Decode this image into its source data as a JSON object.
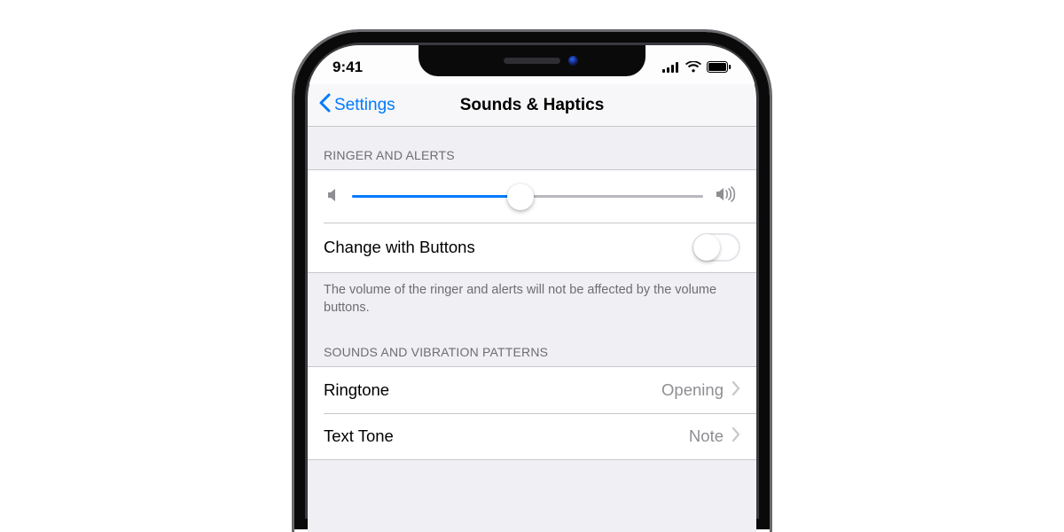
{
  "status": {
    "time": "9:41"
  },
  "nav": {
    "back_label": "Settings",
    "title": "Sounds & Haptics"
  },
  "sections": {
    "ringer": {
      "header": "Ringer and Alerts",
      "slider_percent": 48,
      "change_with_buttons": {
        "label": "Change with Buttons",
        "on": false
      },
      "footer": "The volume of the ringer and alerts will not be affected by the volume buttons."
    },
    "patterns": {
      "header": "Sounds and Vibration Patterns",
      "items": [
        {
          "label": "Ringtone",
          "value": "Opening"
        },
        {
          "label": "Text Tone",
          "value": "Note"
        }
      ]
    }
  }
}
